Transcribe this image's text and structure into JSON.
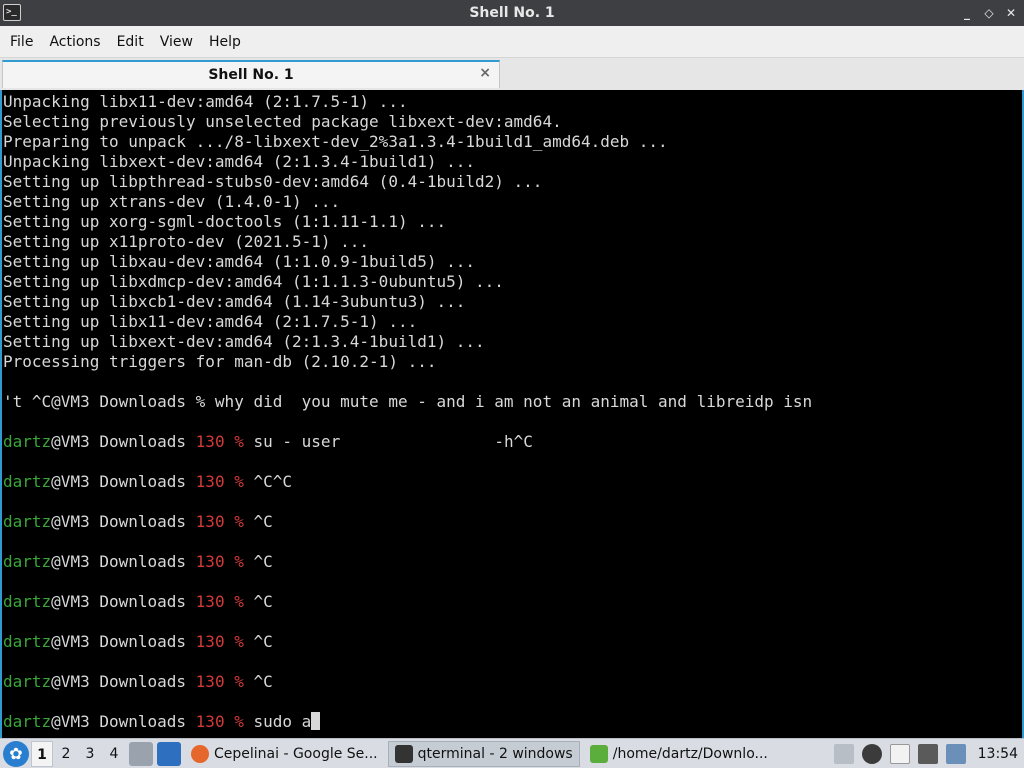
{
  "window": {
    "title": "Shell No. 1",
    "controls": [
      "_",
      "◇",
      "✕"
    ]
  },
  "menu": [
    "File",
    "Actions",
    "Edit",
    "View",
    "Help"
  ],
  "tabs": [
    {
      "label": "Shell No. 1",
      "close": "×"
    }
  ],
  "terminal": {
    "output": [
      "Unpacking libx11-dev:amd64 (2:1.7.5-1) ...",
      "Selecting previously unselected package libxext-dev:amd64.",
      "Preparing to unpack .../8-libxext-dev_2%3a1.3.4-1build1_amd64.deb ...",
      "Unpacking libxext-dev:amd64 (2:1.3.4-1build1) ...",
      "Setting up libpthread-stubs0-dev:amd64 (0.4-1build2) ...",
      "Setting up xtrans-dev (1.4.0-1) ...",
      "Setting up xorg-sgml-doctools (1:1.11-1.1) ...",
      "Setting up x11proto-dev (2021.5-1) ...",
      "Setting up libxau-dev:amd64 (1:1.0.9-1build5) ...",
      "Setting up libxdmcp-dev:amd64 (1:1.1.3-0ubuntu5) ...",
      "Setting up libxcb1-dev:amd64 (1.14-3ubuntu3) ...",
      "Setting up libx11-dev:amd64 (2:1.7.5-1) ...",
      "Setting up libxext-dev:amd64 (2:1.3.4-1build1) ...",
      "Processing triggers for man-db (2.10.2-1) ...",
      "",
      "'t ^C@VM3 Downloads % why did  you mute me - and i am not an animal and libreidp isn"
    ],
    "prompt": {
      "user": "dartz",
      "host_dir": "@VM3 Downloads ",
      "code": "130",
      "symbol": "%"
    },
    "commands": [
      "su - user                -h^C",
      "^C^C",
      "^C",
      "^C",
      "^C",
      "^C",
      "^C",
      "sudo a"
    ]
  },
  "taskbar": {
    "desktops": [
      "1",
      "2",
      "3",
      "4"
    ],
    "tasks": [
      {
        "label": "Cepelinai - Google Se...",
        "icon": "firefox-icon"
      },
      {
        "label": "qterminal - 2 windows",
        "icon": "terminal-icon"
      },
      {
        "label": "/home/dartz/Downlo...",
        "icon": "folder-icon"
      }
    ],
    "clock": "13:54"
  }
}
